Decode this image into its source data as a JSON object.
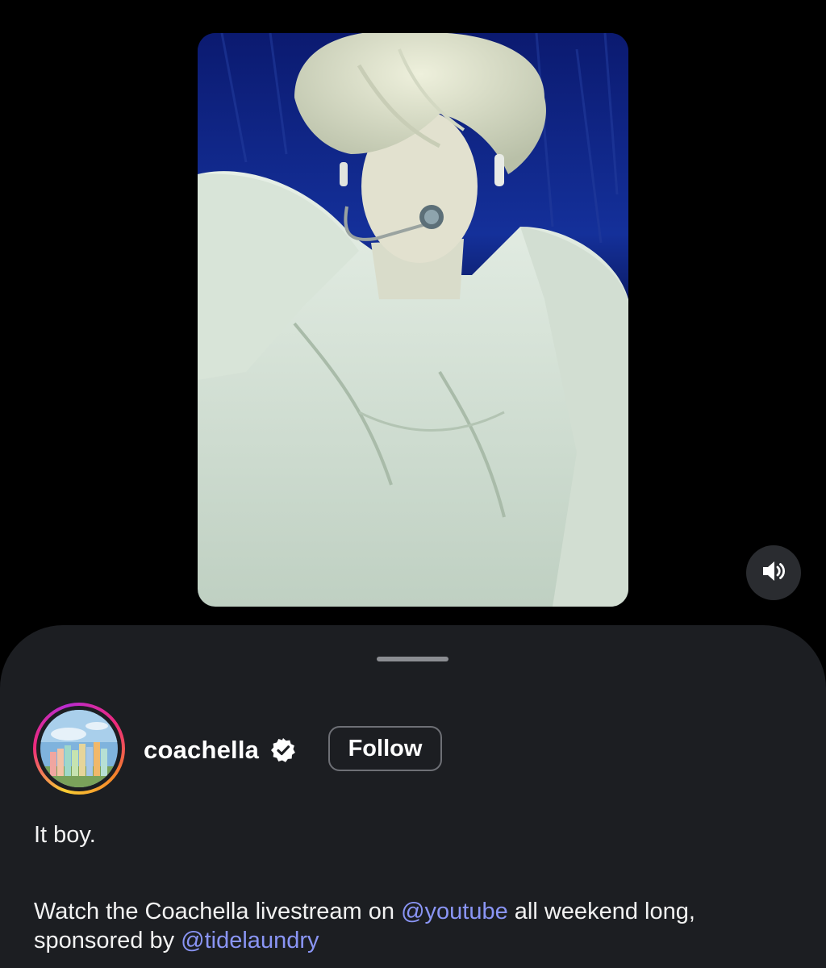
{
  "post": {
    "username": "coachella",
    "verified": true,
    "follow_label": "Follow",
    "caption": {
      "line1": "It boy.",
      "p2_before": "Watch the Coachella livestream on ",
      "mention1": "@youtube",
      "p2_middle": " all weekend long,",
      "p2_line2_before": "sponsored by ",
      "mention2": "@tidelaundry"
    }
  },
  "icons": {
    "volume": "speaker-volume-icon",
    "verified": "verified-badge-icon"
  },
  "colors": {
    "background": "#000000",
    "sheet": "#1c1e22",
    "mention": "#8a95f5",
    "text": "#f2f2f2",
    "follow_border": "#6e7076"
  }
}
